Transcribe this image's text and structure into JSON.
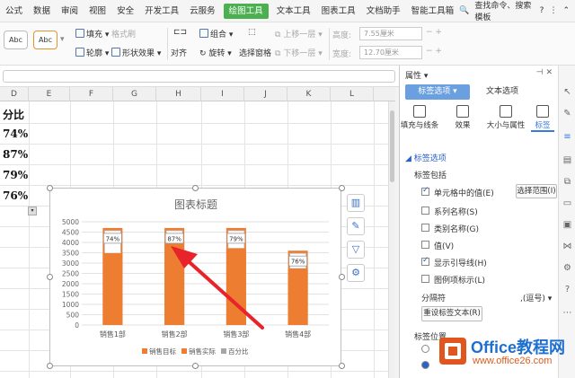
{
  "menu": {
    "items": [
      "公式",
      "数据",
      "审阅",
      "视图",
      "安全",
      "开发工具",
      "云服务",
      "绘图工具",
      "文本工具",
      "图表工具",
      "文档助手",
      "智能工具箱"
    ],
    "search": "查找命令、搜索模板"
  },
  "ribbon": {
    "style_a": "Abc",
    "style_b": "Abc",
    "fill": "填充",
    "outline": "轮廓",
    "text_style": "格式刷",
    "shape_effect": "形状效果",
    "align": "对齐",
    "group": "组合",
    "rotate": "旋转",
    "select_pane": "选择窗格",
    "bring_forward": "上移一层",
    "send_backward": "下移一层",
    "height_label": "高度:",
    "height_value": "7.55厘米",
    "width_label": "宽度:",
    "width_value": "12.70厘米"
  },
  "sheet": {
    "columns": [
      "D",
      "E",
      "F",
      "G",
      "H",
      "I",
      "J",
      "K",
      "L"
    ],
    "d_header": "分比",
    "d_values": [
      "74%",
      "87%",
      "79%",
      "76%"
    ]
  },
  "chart_data": {
    "type": "bar",
    "title": "图表标题",
    "categories": [
      "销售1部",
      "销售2部",
      "销售3部",
      "销售4部"
    ],
    "series": [
      {
        "name": "销售目标",
        "values": [
          4700,
          4700,
          4700,
          3600
        ]
      },
      {
        "name": "销售实际",
        "values": [
          3478,
          4089,
          3713,
          2736
        ]
      },
      {
        "name": "百分比",
        "values": [
          0.74,
          0.87,
          0.79,
          0.76
        ]
      }
    ],
    "data_labels": [
      "74%",
      "87%",
      "79%",
      "76%"
    ],
    "y_ticks": [
      "0",
      "500",
      "1000",
      "1500",
      "2000",
      "2500",
      "3000",
      "3500",
      "4000",
      "4500",
      "5000"
    ],
    "ylim": [
      0,
      5000
    ],
    "grid": true,
    "legend": "bottom"
  },
  "panel": {
    "title": "属性",
    "tab_label_options": "标签选项",
    "tab_text_options": "文本选项",
    "sub_tabs": [
      "填充与线条",
      "效果",
      "大小与属性",
      "标签"
    ],
    "section": "标签选项",
    "contains": "标签包括",
    "cell_value": "单元格中的值(E)",
    "select_range": "选择范围(I)",
    "series_name": "系列名称(S)",
    "category_name": "类别名称(G)",
    "value": "值(V)",
    "leader_lines": "显示引导线(H)",
    "legend_key": "图例项标示(L)",
    "separator": "分隔符",
    "separator_value": ",(逗号)",
    "reset_text": "重设标签文本(R)",
    "label_position": "标签位置"
  },
  "watermark": {
    "title": "Office教程网",
    "url": "www.office26.com"
  },
  "colors": {
    "bar": "#ed7d31",
    "accent": "#4caf50",
    "arrow": "#e8232a",
    "tab": "#6a9fe0"
  }
}
